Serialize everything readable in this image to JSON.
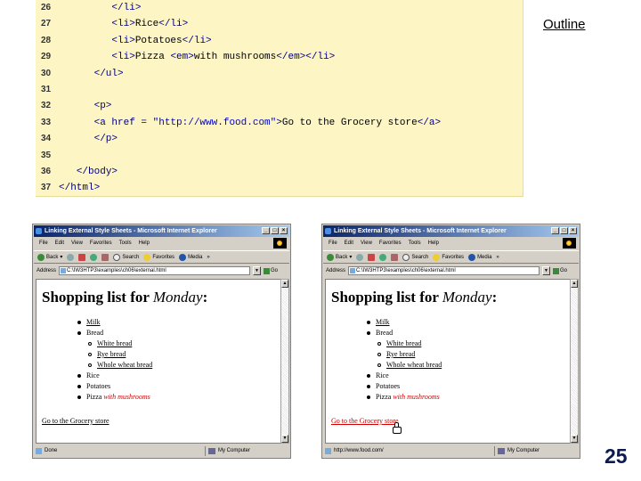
{
  "slide": {
    "outline_label": "Outline",
    "page_number": "25"
  },
  "code": {
    "lines": [
      {
        "num": "26",
        "parts": [
          {
            "t": "         "
          },
          {
            "t": "</li>",
            "c": "tg"
          }
        ]
      },
      {
        "num": "27",
        "parts": [
          {
            "t": "         "
          },
          {
            "t": "<li>",
            "c": "tg"
          },
          {
            "t": "Rice"
          },
          {
            "t": "</li>",
            "c": "tg"
          }
        ]
      },
      {
        "num": "28",
        "parts": [
          {
            "t": "         "
          },
          {
            "t": "<li>",
            "c": "tg"
          },
          {
            "t": "Potatoes"
          },
          {
            "t": "</li>",
            "c": "tg"
          }
        ]
      },
      {
        "num": "29",
        "parts": [
          {
            "t": "         "
          },
          {
            "t": "<li>",
            "c": "tg"
          },
          {
            "t": "Pizza "
          },
          {
            "t": "<em>",
            "c": "tg"
          },
          {
            "t": "with mushrooms"
          },
          {
            "t": "</em></li>",
            "c": "tg"
          }
        ]
      },
      {
        "num": "30",
        "parts": [
          {
            "t": "      "
          },
          {
            "t": "</ul>",
            "c": "tg"
          }
        ]
      },
      {
        "num": "31",
        "parts": []
      },
      {
        "num": "32",
        "parts": [
          {
            "t": "      "
          },
          {
            "t": "<p>",
            "c": "tg"
          }
        ]
      },
      {
        "num": "33",
        "parts": [
          {
            "t": "      "
          },
          {
            "t": "<a href = ",
            "c": "tg"
          },
          {
            "t": "\"http://www.food.com\"",
            "c": "st"
          },
          {
            "t": ">",
            "c": "tg"
          },
          {
            "t": "Go to the Grocery store"
          },
          {
            "t": "</a>",
            "c": "tg"
          }
        ]
      },
      {
        "num": "34",
        "parts": [
          {
            "t": "      "
          },
          {
            "t": "</p>",
            "c": "tg"
          }
        ]
      },
      {
        "num": "35",
        "parts": []
      },
      {
        "num": "36",
        "parts": [
          {
            "t": "   "
          },
          {
            "t": "</body>",
            "c": "tg"
          }
        ]
      },
      {
        "num": "37",
        "parts": [
          {
            "t": "</html>",
            "c": "tg"
          }
        ]
      }
    ]
  },
  "browser": {
    "title": "Linking External Style Sheets - Microsoft Internet Explorer",
    "menu": [
      "File",
      "Edit",
      "View",
      "Favorites",
      "Tools",
      "Help"
    ],
    "toolbar": {
      "back": "Back",
      "search": "Search",
      "favorites": "Favorites",
      "media": "Media"
    },
    "address_label": "Address",
    "address_value": "C:\\IW3HTP3\\examples\\ch06\\external.html",
    "go_label": "Go",
    "heading_prefix": "Shopping list for ",
    "heading_day": "Monday",
    "heading_suffix": ":",
    "items": {
      "milk": "Milk",
      "bread": "Bread",
      "white": "White bread",
      "rye": "Rye bread",
      "whole": "Whole wheat bread",
      "rice": "Rice",
      "potatoes": "Potatoes",
      "pizza": "Pizza ",
      "pizza_em": "with mushrooms"
    },
    "link_text": "Go to the Grocery store",
    "zone": "My Computer"
  },
  "windows": {
    "left": {
      "status": "Done"
    },
    "right": {
      "status": "http://www.food.com/"
    }
  },
  "colors": {
    "code_bg": "#fdf5c4",
    "titlebar_start": "#0a246a",
    "emphasis_red": "#cc0000"
  }
}
